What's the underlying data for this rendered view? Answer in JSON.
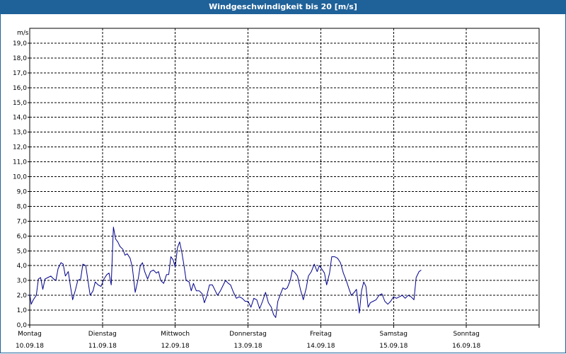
{
  "window": {
    "title": "Windgeschwindigkeit bis 20 [m/s]"
  },
  "colors": {
    "titlebar": "#1f6199",
    "series": "#00008b",
    "grid": "#000000"
  },
  "chart_data": {
    "type": "line",
    "title": "Windgeschwindigkeit bis 20 [m/s]",
    "ylabel": "m/s",
    "ylim": [
      0,
      20
    ],
    "yticks": [
      "0,0",
      "1,0",
      "2,0",
      "3,0",
      "4,0",
      "5,0",
      "6,0",
      "7,0",
      "8,0",
      "9,0",
      "10,0",
      "11,0",
      "12,0",
      "13,0",
      "14,0",
      "15,0",
      "16,0",
      "17,0",
      "18,0",
      "19,0"
    ],
    "xlim_days": [
      0,
      7
    ],
    "x_labels": [
      {
        "day": "Montag",
        "date": "10.09.18"
      },
      {
        "day": "Dienstag",
        "date": "11.09.18"
      },
      {
        "day": "Mittwoch",
        "date": "12.09.18"
      },
      {
        "day": "Donnerstag",
        "date": "13.09.18"
      },
      {
        "day": "Freitag",
        "date": "14.09.18"
      },
      {
        "day": "Samstag",
        "date": "15.09.18"
      },
      {
        "day": "Sonntag",
        "date": "16.09.18"
      }
    ],
    "grid": true,
    "series": [
      {
        "color": "#00008b",
        "points": [
          [
            0.0,
            2.1
          ],
          [
            0.02,
            1.4
          ],
          [
            0.05,
            1.7
          ],
          [
            0.09,
            2.0
          ],
          [
            0.12,
            3.1
          ],
          [
            0.15,
            3.2
          ],
          [
            0.18,
            2.4
          ],
          [
            0.21,
            3.1
          ],
          [
            0.25,
            3.2
          ],
          [
            0.29,
            3.3
          ],
          [
            0.33,
            3.1
          ],
          [
            0.36,
            3.0
          ],
          [
            0.39,
            3.8
          ],
          [
            0.43,
            4.2
          ],
          [
            0.46,
            4.1
          ],
          [
            0.49,
            3.3
          ],
          [
            0.53,
            3.6
          ],
          [
            0.56,
            2.6
          ],
          [
            0.59,
            1.7
          ],
          [
            0.63,
            2.4
          ],
          [
            0.66,
            3.0
          ],
          [
            0.7,
            3.1
          ],
          [
            0.73,
            4.1
          ],
          [
            0.77,
            4.0
          ],
          [
            0.8,
            3.0
          ],
          [
            0.83,
            2.0
          ],
          [
            0.87,
            2.3
          ],
          [
            0.9,
            2.9
          ],
          [
            0.94,
            2.7
          ],
          [
            0.98,
            2.6
          ],
          [
            1.02,
            3.1
          ],
          [
            1.06,
            3.4
          ],
          [
            1.09,
            3.5
          ],
          [
            1.12,
            2.7
          ],
          [
            1.15,
            6.6
          ],
          [
            1.18,
            5.8
          ],
          [
            1.21,
            5.6
          ],
          [
            1.24,
            5.3
          ],
          [
            1.28,
            5.1
          ],
          [
            1.31,
            4.7
          ],
          [
            1.34,
            4.8
          ],
          [
            1.38,
            4.5
          ],
          [
            1.41,
            3.9
          ],
          [
            1.45,
            2.2
          ],
          [
            1.49,
            3.1
          ],
          [
            1.52,
            4.0
          ],
          [
            1.55,
            4.2
          ],
          [
            1.58,
            3.6
          ],
          [
            1.62,
            3.1
          ],
          [
            1.66,
            3.6
          ],
          [
            1.7,
            3.7
          ],
          [
            1.74,
            3.5
          ],
          [
            1.77,
            3.6
          ],
          [
            1.8,
            3.0
          ],
          [
            1.84,
            2.8
          ],
          [
            1.88,
            3.4
          ],
          [
            1.91,
            3.4
          ],
          [
            1.94,
            4.6
          ],
          [
            1.97,
            4.4
          ],
          [
            2.0,
            3.9
          ],
          [
            2.03,
            5.2
          ],
          [
            2.06,
            5.6
          ],
          [
            2.09,
            4.9
          ],
          [
            2.12,
            4.0
          ],
          [
            2.15,
            3.0
          ],
          [
            2.19,
            2.9
          ],
          [
            2.22,
            2.3
          ],
          [
            2.25,
            2.8
          ],
          [
            2.29,
            2.3
          ],
          [
            2.33,
            2.3
          ],
          [
            2.37,
            2.1
          ],
          [
            2.4,
            1.5
          ],
          [
            2.43,
            1.9
          ],
          [
            2.47,
            2.7
          ],
          [
            2.51,
            2.7
          ],
          [
            2.54,
            2.4
          ],
          [
            2.58,
            2.0
          ],
          [
            2.62,
            2.3
          ],
          [
            2.65,
            2.6
          ],
          [
            2.69,
            3.0
          ],
          [
            2.73,
            2.8
          ],
          [
            2.76,
            2.7
          ],
          [
            2.8,
            2.2
          ],
          [
            2.84,
            1.8
          ],
          [
            2.88,
            1.9
          ],
          [
            2.92,
            1.8
          ],
          [
            2.96,
            1.6
          ],
          [
            3.0,
            1.6
          ],
          [
            3.04,
            1.2
          ],
          [
            3.08,
            1.8
          ],
          [
            3.12,
            1.7
          ],
          [
            3.16,
            1.1
          ],
          [
            3.2,
            1.6
          ],
          [
            3.24,
            2.2
          ],
          [
            3.28,
            1.5
          ],
          [
            3.32,
            1.2
          ],
          [
            3.35,
            0.7
          ],
          [
            3.38,
            0.5
          ],
          [
            3.41,
            1.6
          ],
          [
            3.44,
            2.0
          ],
          [
            3.48,
            2.5
          ],
          [
            3.51,
            2.4
          ],
          [
            3.54,
            2.5
          ],
          [
            3.58,
            3.0
          ],
          [
            3.61,
            3.7
          ],
          [
            3.65,
            3.5
          ],
          [
            3.68,
            3.3
          ],
          [
            3.72,
            2.4
          ],
          [
            3.76,
            1.7
          ],
          [
            3.8,
            2.5
          ],
          [
            3.83,
            3.3
          ],
          [
            3.87,
            3.6
          ],
          [
            3.91,
            4.1
          ],
          [
            3.95,
            3.6
          ],
          [
            3.98,
            4.0
          ],
          [
            4.01,
            3.8
          ],
          [
            4.05,
            3.5
          ],
          [
            4.08,
            2.7
          ],
          [
            4.12,
            3.5
          ],
          [
            4.15,
            4.6
          ],
          [
            4.19,
            4.6
          ],
          [
            4.23,
            4.5
          ],
          [
            4.27,
            4.2
          ],
          [
            4.31,
            3.5
          ],
          [
            4.35,
            3.0
          ],
          [
            4.39,
            2.4
          ],
          [
            4.42,
            2.0
          ],
          [
            4.46,
            2.2
          ],
          [
            4.49,
            2.4
          ],
          [
            4.53,
            0.8
          ],
          [
            4.56,
            2.3
          ],
          [
            4.59,
            2.9
          ],
          [
            4.62,
            2.6
          ],
          [
            4.65,
            1.2
          ],
          [
            4.68,
            1.5
          ],
          [
            4.72,
            1.6
          ],
          [
            4.76,
            1.7
          ],
          [
            4.8,
            2.0
          ],
          [
            4.84,
            2.1
          ],
          [
            4.88,
            1.6
          ],
          [
            4.92,
            1.4
          ],
          [
            4.96,
            1.6
          ],
          [
            5.0,
            1.9
          ],
          [
            5.04,
            1.8
          ],
          [
            5.08,
            1.9
          ],
          [
            5.12,
            2.0
          ],
          [
            5.16,
            1.8
          ],
          [
            5.2,
            2.0
          ],
          [
            5.24,
            1.9
          ],
          [
            5.28,
            1.7
          ],
          [
            5.31,
            3.2
          ],
          [
            5.35,
            3.6
          ],
          [
            5.38,
            3.7
          ]
        ]
      }
    ]
  }
}
